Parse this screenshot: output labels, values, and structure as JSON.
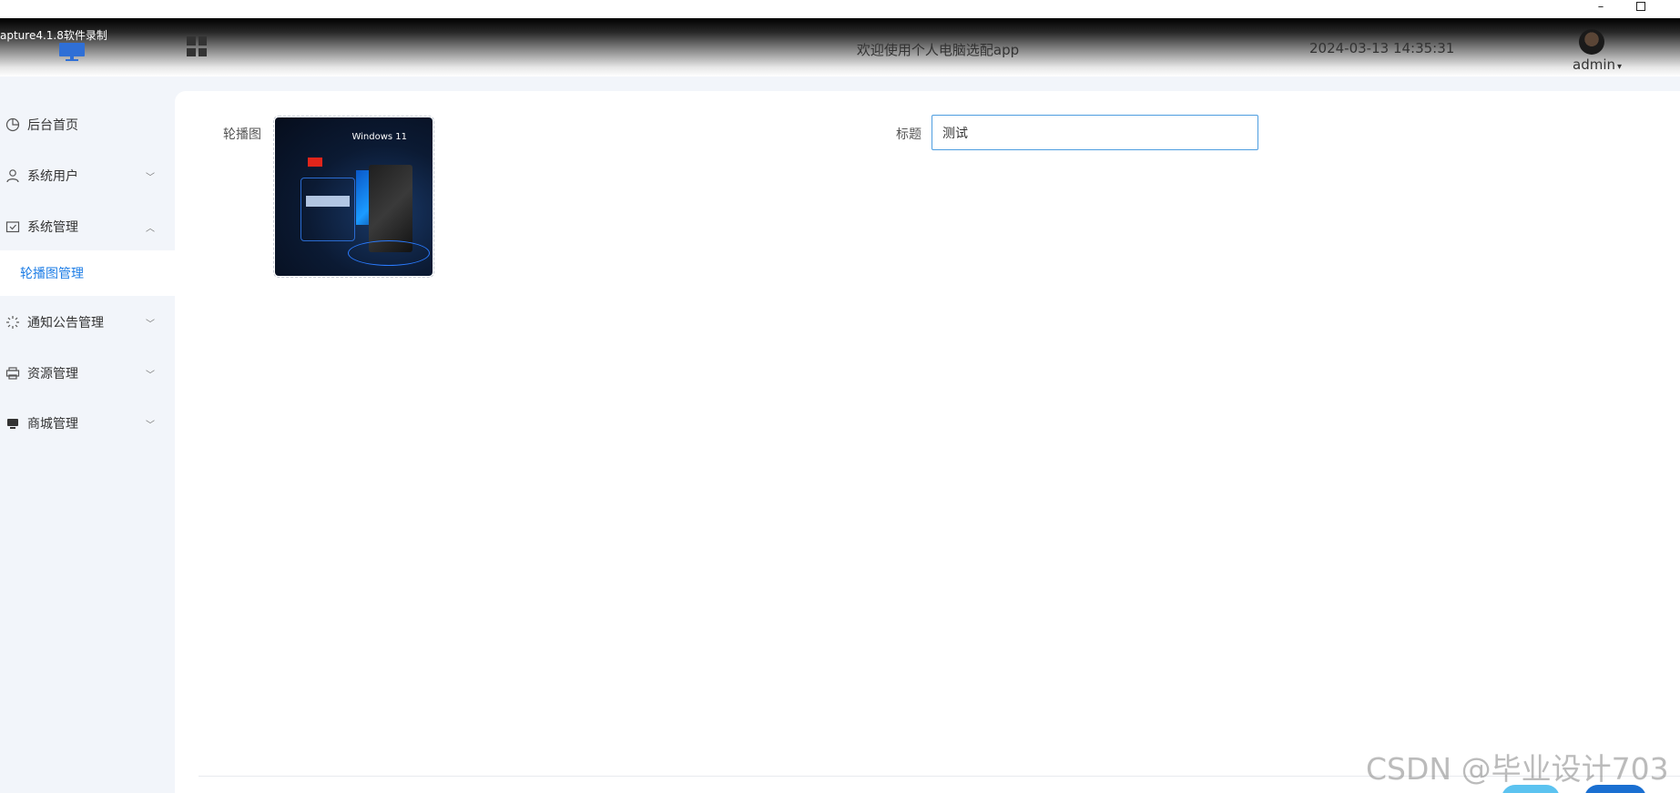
{
  "window": {
    "minimize_glyph": "–"
  },
  "header": {
    "capture_label": "apture4.1.8软件录制",
    "title": "欢迎使用个人电脑选配app",
    "datetime": "2024-03-13 14:35:31",
    "user_name": "admin",
    "user_caret": "▾"
  },
  "sidebar": {
    "items": [
      {
        "label": "后台首页",
        "icon": "pie-chart-icon",
        "arrow": ""
      },
      {
        "label": "系统用户",
        "icon": "user-icon",
        "arrow": "﹀"
      },
      {
        "label": "系统管理",
        "icon": "folder-check-icon",
        "arrow": "︿"
      },
      {
        "label": "通知公告管理",
        "icon": "loading-burst-icon",
        "arrow": "﹀"
      },
      {
        "label": "资源管理",
        "icon": "printer-icon",
        "arrow": "﹀"
      },
      {
        "label": "商城管理",
        "icon": "monitor-icon",
        "arrow": "﹀"
      }
    ],
    "active_submenu": "轮播图管理"
  },
  "form": {
    "carousel_label": "轮播图",
    "carousel_image_caption": "Windows 11",
    "title_label": "标题",
    "title_value": "测试"
  },
  "colors": {
    "accent": "#1e7ee6",
    "input_border": "#4d9de0",
    "cancel_button": "#5cc3f0",
    "submit_button": "#1a6fd1"
  },
  "watermark": "CSDN @毕业设计703"
}
